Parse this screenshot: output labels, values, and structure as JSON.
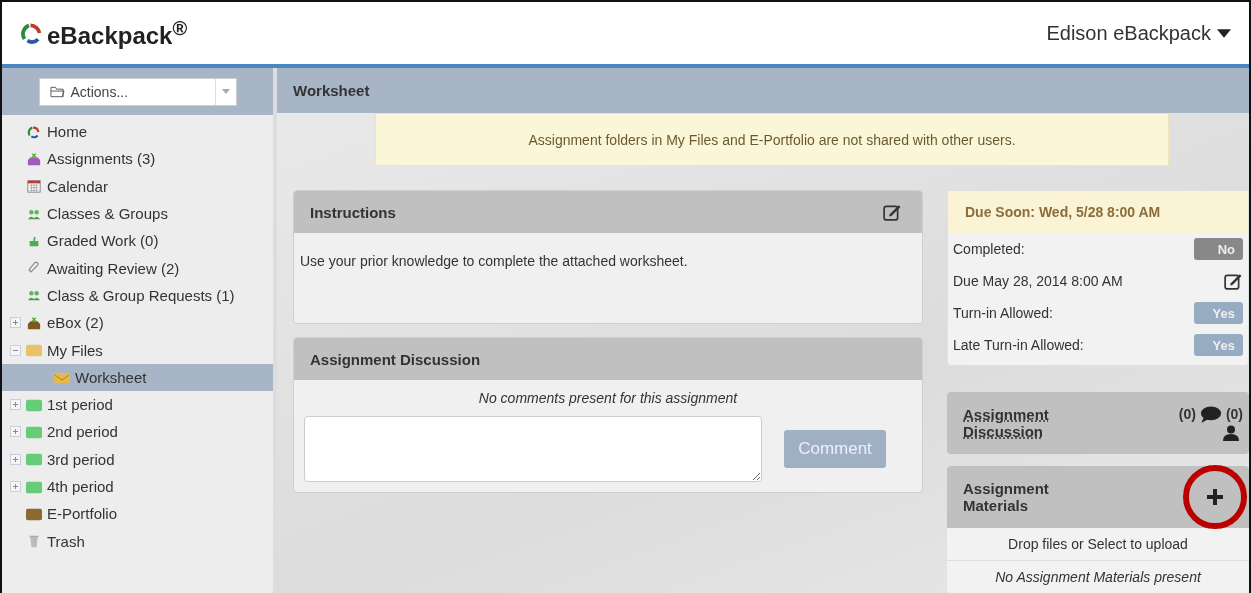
{
  "header": {
    "logo": "eBackpack$^{®}$",
    "user_menu": "Edison eBackpack"
  },
  "sidebar": {
    "actions": {
      "label": "Actions..."
    },
    "items": [
      {
        "kind": "home",
        "label": "Home",
        "selected": false
      },
      {
        "kind": "assignments",
        "label": "Assignments (3)",
        "selected": false
      },
      {
        "kind": "calendar",
        "label": "Calendar",
        "selected": false
      },
      {
        "kind": "classes",
        "label": "Classes & Groups",
        "selected": false
      },
      {
        "kind": "graded",
        "label": "Graded Work (0)",
        "selected": false
      },
      {
        "kind": "review",
        "label": "Awaiting Review (2)",
        "selected": false
      },
      {
        "kind": "requests",
        "label": "Class & Group Requests (1)",
        "selected": false
      },
      {
        "kind": "ebox",
        "label": "eBox (2)",
        "selected": false,
        "expanded": false
      },
      {
        "kind": "folder",
        "label": "My Files",
        "color": "#e8c36a",
        "selected": false,
        "expanded": true,
        "children": [
          {
            "kind": "assignment-folder",
            "label": "Worksheet",
            "selected": true
          }
        ]
      },
      {
        "kind": "folder",
        "label": "1st period",
        "color": "#66cc77",
        "selected": false,
        "expanded": false
      },
      {
        "kind": "folder",
        "label": "2nd period",
        "color": "#66cc77",
        "selected": false,
        "expanded": false
      },
      {
        "kind": "folder",
        "label": "3rd period",
        "color": "#66cc77",
        "selected": false,
        "expanded": false
      },
      {
        "kind": "folder",
        "label": "4th period",
        "color": "#66cc77",
        "selected": false,
        "expanded": false
      },
      {
        "kind": "folder",
        "label": "E-Portfolio",
        "color": "#8a6a2e",
        "selected": false
      },
      {
        "kind": "trash",
        "label": "Trash",
        "selected": false
      }
    ]
  },
  "content": {
    "title": "Worksheet",
    "notice": "Assignment folders in My Files and E-Portfolio are not shared with other users.",
    "instructions": {
      "title": "Instructions",
      "text": "Use your prior knowledge to complete the attached worksheet."
    },
    "discussion": {
      "title": "Assignment Discussion",
      "empty_text": "No comments present for this assignment",
      "button": "Comment"
    },
    "due_card": {
      "title": "Due Soon: Wed, 5/28 8:00 AM",
      "rows": [
        {
          "kind": "badge",
          "label": "Completed:",
          "value": "No",
          "on": false
        },
        {
          "kind": "edit",
          "label": "Due May 28, 2014 8:00 AM"
        },
        {
          "kind": "badge",
          "label": "Turn-in Allowed:",
          "value": "Yes",
          "on": true
        },
        {
          "kind": "badge",
          "label": "Late Turn-in Allowed:",
          "value": "Yes",
          "on": true
        }
      ]
    },
    "discussion_card": {
      "title": "Assignment Discussion",
      "comment_count": "(0)",
      "participant_count": "(0)"
    },
    "materials_card": {
      "title": "Assignment Materials",
      "drop_text": "Drop files or Select to upload",
      "empty_text": "No Assignment Materials present"
    }
  }
}
